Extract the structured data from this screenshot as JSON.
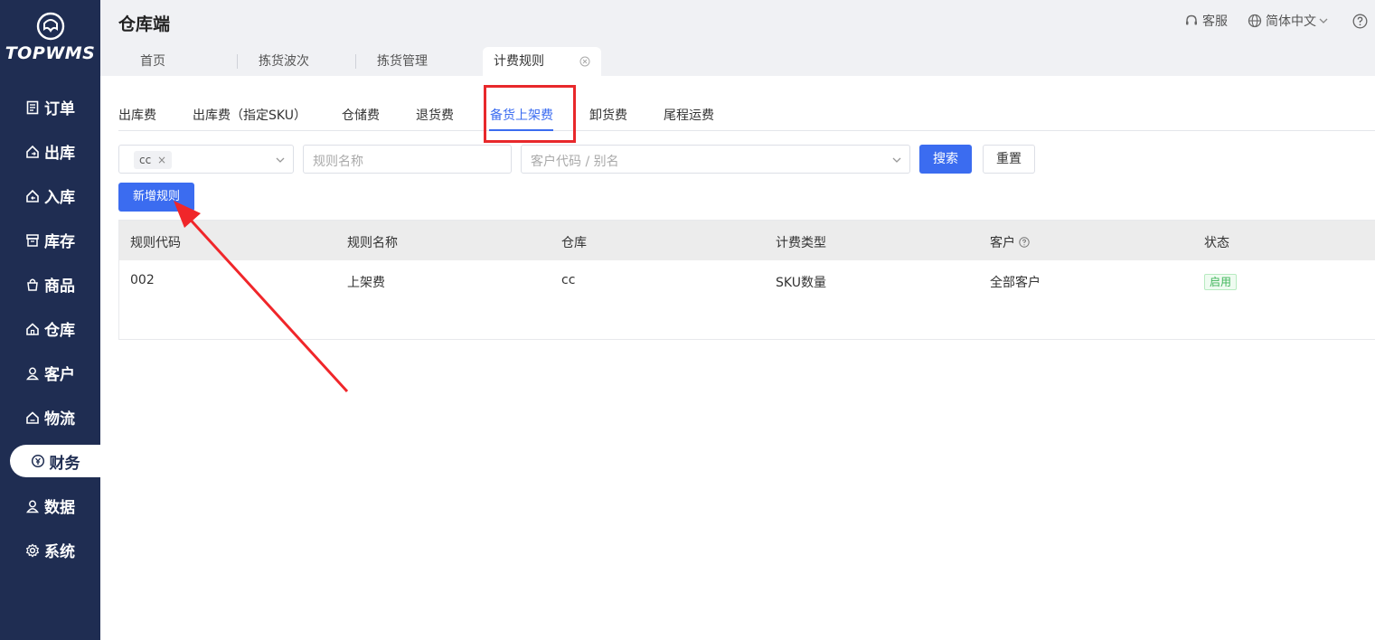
{
  "brand": {
    "logo_text": "TOPWMS"
  },
  "sidebar": {
    "items": [
      {
        "label": "订单",
        "icon": "order-icon"
      },
      {
        "label": "出库",
        "icon": "outbound-icon"
      },
      {
        "label": "入库",
        "icon": "inbound-icon"
      },
      {
        "label": "库存",
        "icon": "inventory-icon"
      },
      {
        "label": "商品",
        "icon": "product-icon"
      },
      {
        "label": "仓库",
        "icon": "warehouse-icon"
      },
      {
        "label": "客户",
        "icon": "customer-icon"
      },
      {
        "label": "物流",
        "icon": "logistics-icon"
      },
      {
        "label": "财务",
        "icon": "finance-icon",
        "active": true
      },
      {
        "label": "数据",
        "icon": "data-icon"
      },
      {
        "label": "系统",
        "icon": "settings-icon"
      }
    ]
  },
  "header": {
    "title": "仓库端",
    "support_label": "客服",
    "language_label": "简体中文",
    "help_icon": "help-icon"
  },
  "tabs": [
    {
      "label": "首页"
    },
    {
      "label": "拣货波次"
    },
    {
      "label": "拣货管理"
    },
    {
      "label": "计费规则",
      "active": true
    }
  ],
  "subtabs": [
    {
      "label": "出库费"
    },
    {
      "label": "出库费（指定SKU）"
    },
    {
      "label": "仓储费"
    },
    {
      "label": "退货费"
    },
    {
      "label": "备货上架费",
      "active": true
    },
    {
      "label": "卸货费"
    },
    {
      "label": "尾程运费"
    }
  ],
  "filters": {
    "warehouse_tag": "cc",
    "rule_name_placeholder": "规则名称",
    "customer_placeholder": "客户代码 / 别名",
    "search_label": "搜索",
    "reset_label": "重置"
  },
  "add_rule_label": "新增规则",
  "table": {
    "columns": [
      "规则代码",
      "规则名称",
      "仓库",
      "计费类型",
      "客户",
      "状态"
    ],
    "rows": [
      {
        "code": "002",
        "name": "上架费",
        "warehouse": "cc",
        "billing_type": "SKU数量",
        "customer": "全部客户",
        "status": "启用"
      }
    ]
  },
  "colors": {
    "sidebar": "#1f2d52",
    "accent": "#3b6cf0",
    "highlight": "#e8282b",
    "status_green": "#3fb55a"
  }
}
